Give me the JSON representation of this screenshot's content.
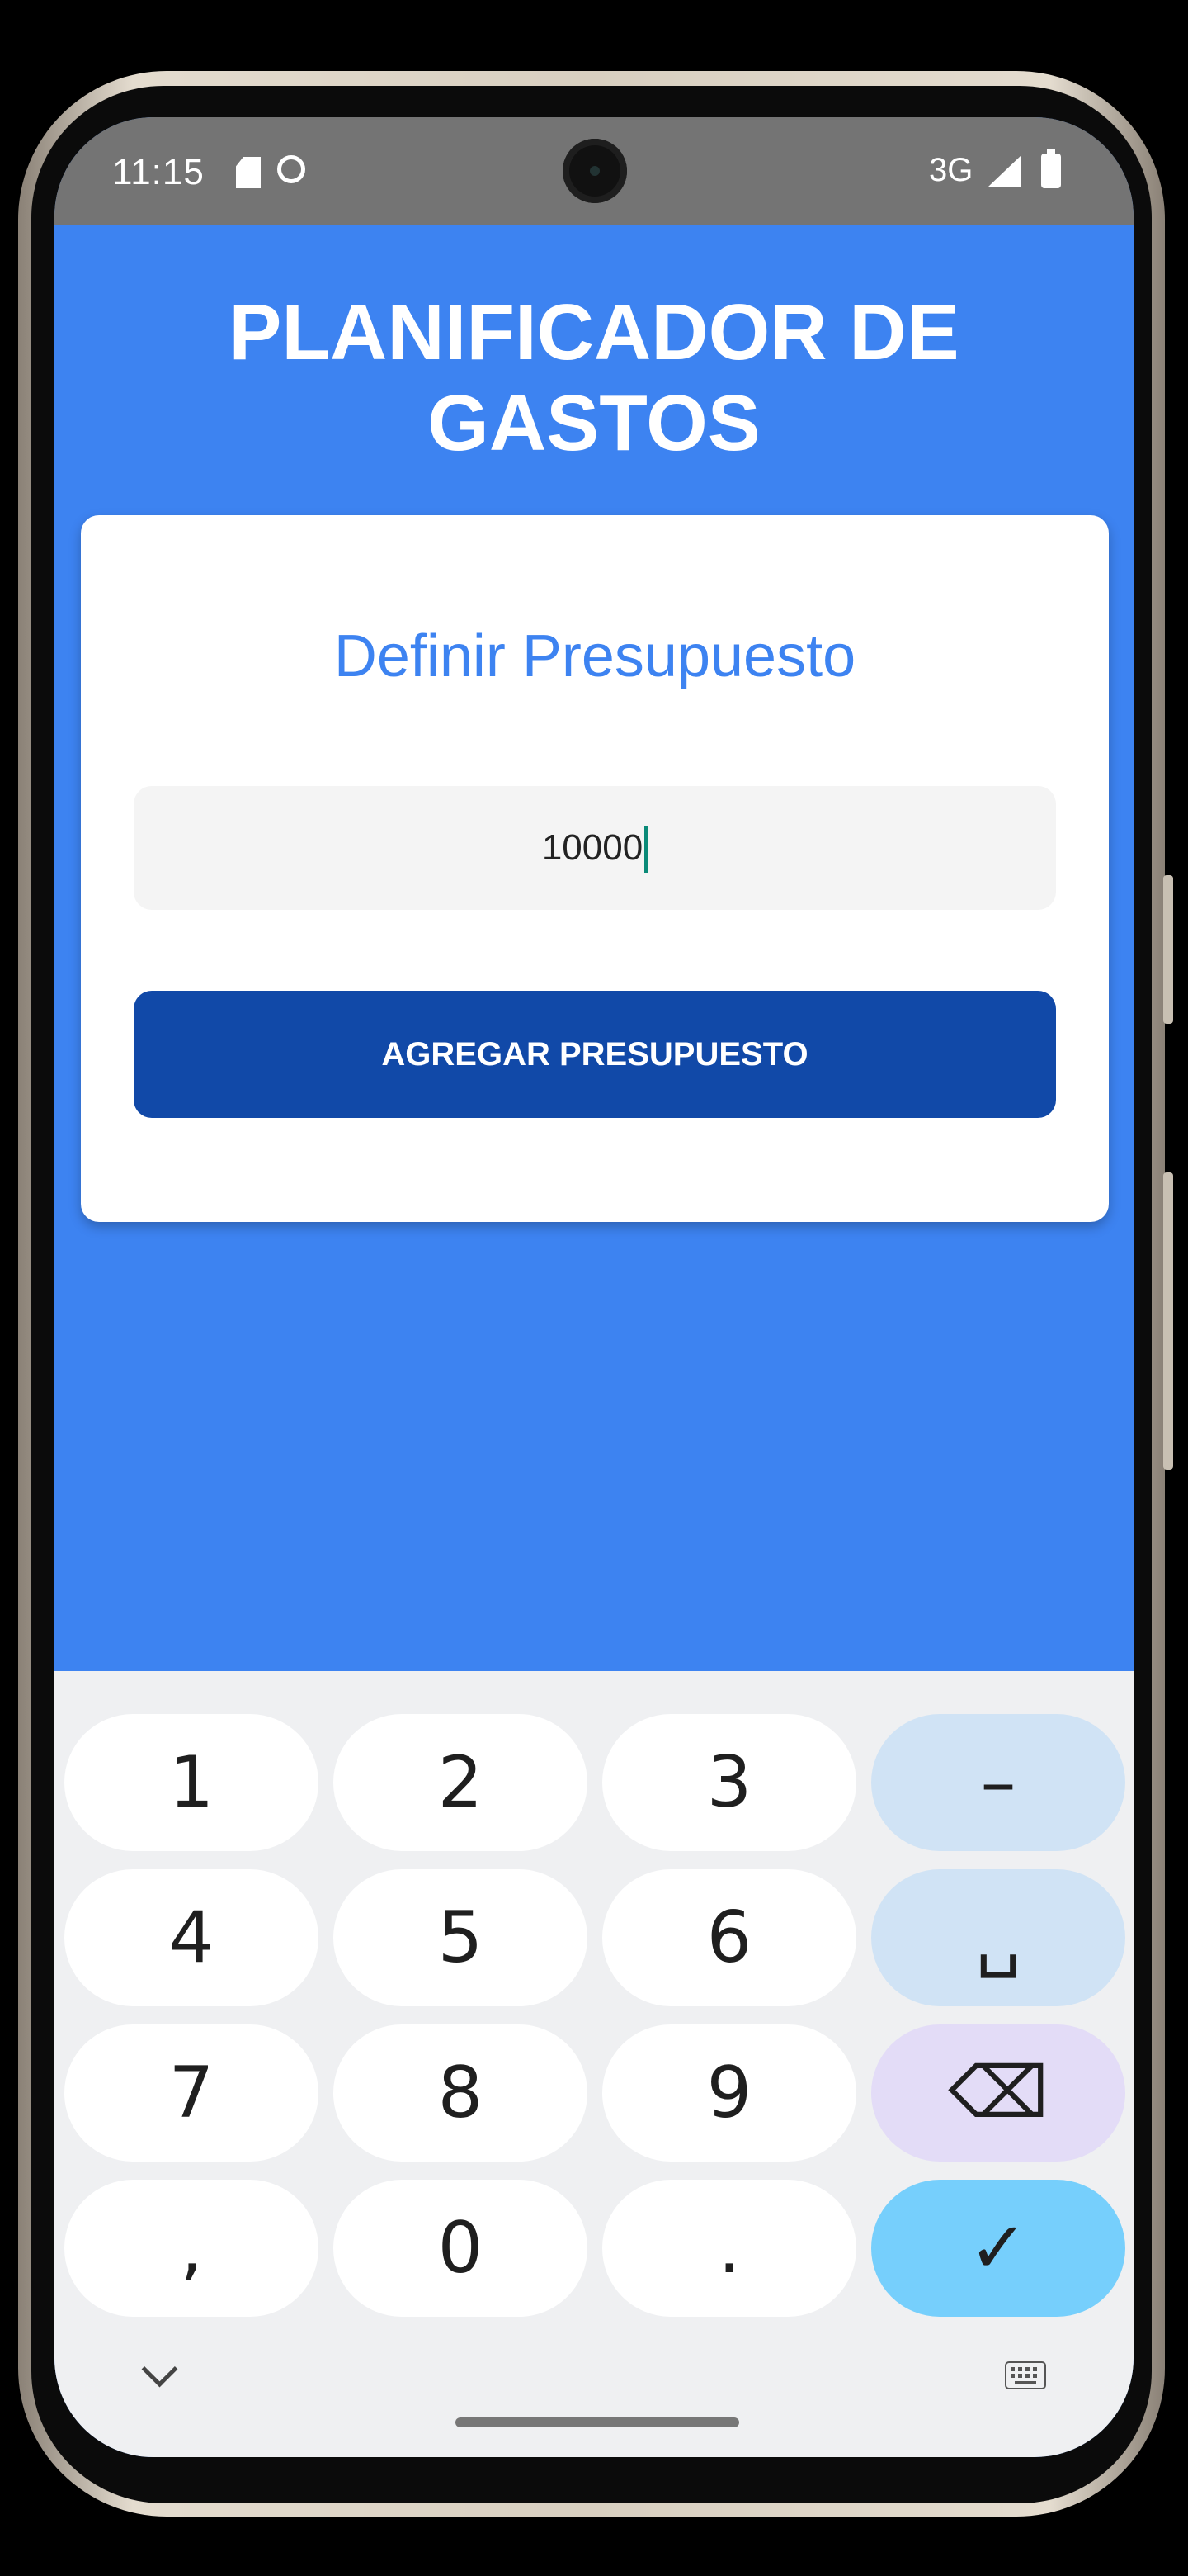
{
  "statusbar": {
    "time": "11:15",
    "network": "3G",
    "icons": [
      "sd-card-icon",
      "face-icon",
      "signal-icon",
      "battery-icon"
    ]
  },
  "app": {
    "title": "PLANIFICADOR DE GASTOS",
    "background_color": "#3d83f1"
  },
  "budget_card": {
    "title": "Definir Presupuesto",
    "input_value": "10000",
    "button_label": "AGREGAR PRESUPUESTO",
    "button_color": "#1149a8"
  },
  "keyboard": {
    "keys": [
      {
        "label": "1"
      },
      {
        "label": "2"
      },
      {
        "label": "3"
      },
      {
        "label": "–"
      },
      {
        "label": "4"
      },
      {
        "label": "5"
      },
      {
        "label": "6"
      },
      {
        "label": "␣"
      },
      {
        "label": "7"
      },
      {
        "label": "8"
      },
      {
        "label": "9"
      },
      {
        "label": "⌫"
      },
      {
        "label": ","
      },
      {
        "label": "0"
      },
      {
        "label": "."
      },
      {
        "label": "✓"
      }
    ],
    "icons": [
      "chevron-down-icon",
      "keyboard-icon"
    ]
  }
}
